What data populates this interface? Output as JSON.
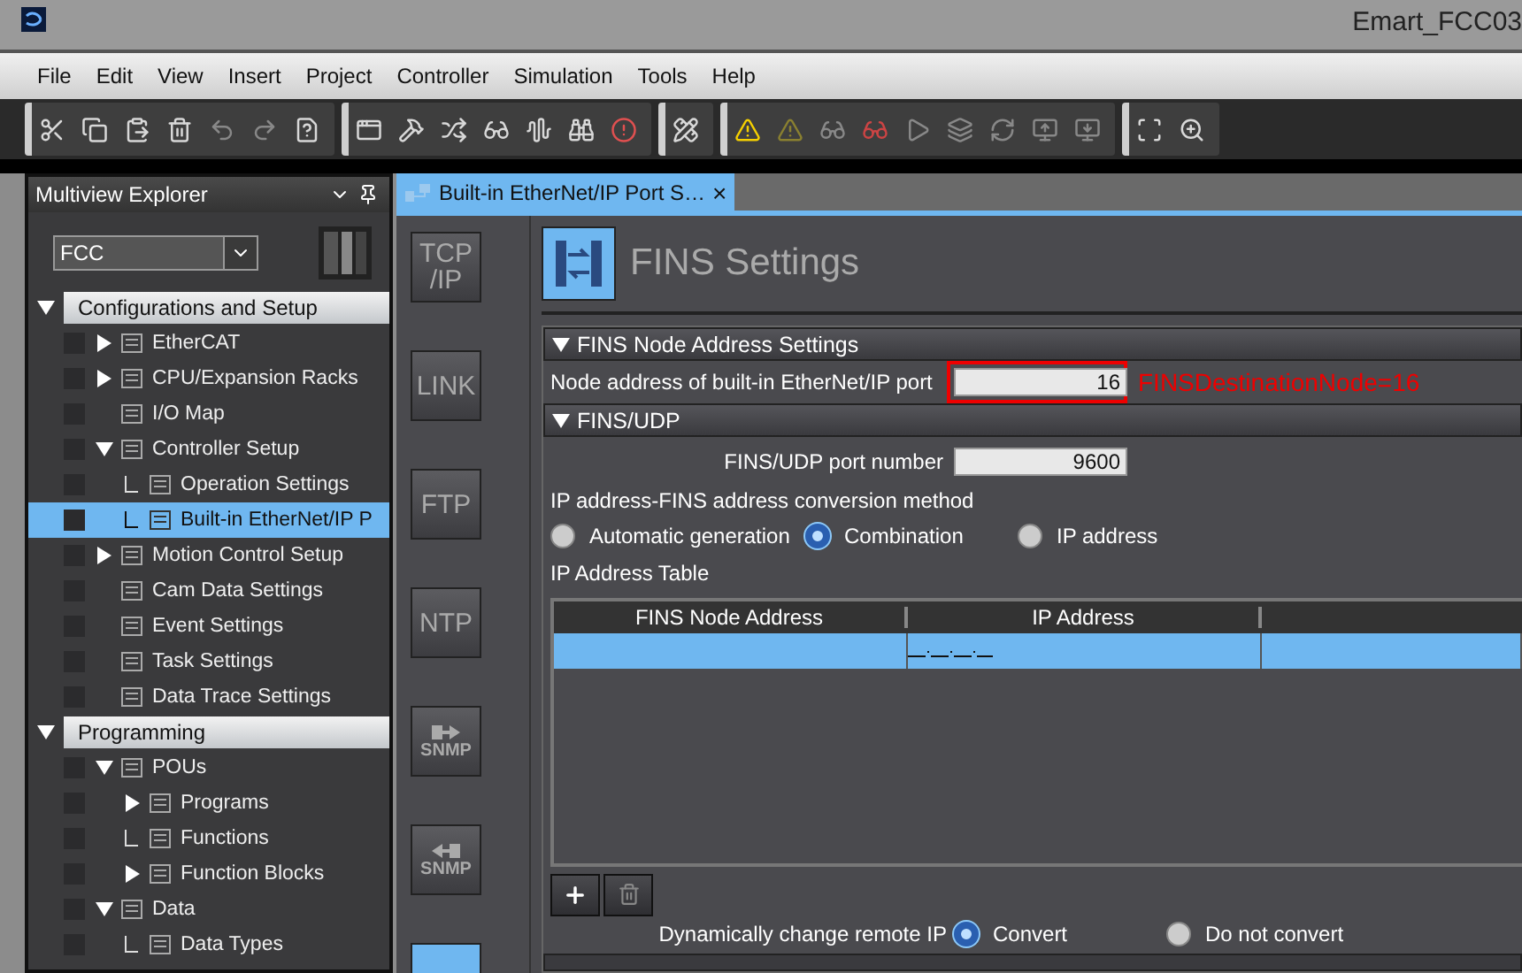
{
  "window": {
    "title": "Emart_FCC03"
  },
  "menu": [
    "File",
    "Edit",
    "View",
    "Insert",
    "Project",
    "Controller",
    "Simulation",
    "Tools",
    "Help"
  ],
  "explorer": {
    "title": "Multiview Explorer",
    "device": "FCC",
    "tree": [
      {
        "kind": "category",
        "label": "Configurations and Setup",
        "expanded": true,
        "selected": false,
        "children": [
          {
            "kind": "item",
            "label": "EtherCAT",
            "expanded": false,
            "selected": false
          },
          {
            "kind": "item",
            "label": "CPU/Expansion Racks",
            "expanded": false,
            "selected": false
          },
          {
            "kind": "item",
            "label": "I/O Map",
            "selected": false
          },
          {
            "kind": "item",
            "label": "Controller Setup",
            "expanded": true,
            "selected": false,
            "children": [
              {
                "kind": "item",
                "label": "Operation Settings",
                "selected": false
              },
              {
                "kind": "item",
                "label": "Built-in EtherNet/IP P",
                "selected": true
              }
            ]
          },
          {
            "kind": "item",
            "label": "Motion Control Setup",
            "expanded": false,
            "selected": false
          },
          {
            "kind": "item",
            "label": "Cam Data Settings",
            "selected": false
          },
          {
            "kind": "item",
            "label": "Event Settings",
            "selected": false
          },
          {
            "kind": "item",
            "label": "Task Settings",
            "selected": false
          },
          {
            "kind": "item",
            "label": "Data Trace Settings",
            "selected": false
          }
        ]
      },
      {
        "kind": "category",
        "label": "Programming",
        "expanded": true,
        "selected": false,
        "children": [
          {
            "kind": "item",
            "label": "POUs",
            "expanded": true,
            "selected": false,
            "children": [
              {
                "kind": "item",
                "label": "Programs",
                "expanded": false,
                "selected": false
              },
              {
                "kind": "item",
                "label": "Functions",
                "selected": false
              },
              {
                "kind": "item",
                "label": "Function Blocks",
                "expanded": false,
                "selected": false
              }
            ]
          },
          {
            "kind": "item",
            "label": "Data",
            "expanded": true,
            "selected": false,
            "children": [
              {
                "kind": "item",
                "label": "Data Types",
                "selected": false
              }
            ]
          }
        ]
      }
    ]
  },
  "editor": {
    "tab": {
      "label": "Built-in EtherNet/IP Port S…",
      "selected": true,
      "close": "×"
    },
    "nav": [
      {
        "kind": "text",
        "label": "TCP\n/IP",
        "selected": false
      },
      {
        "kind": "text",
        "label": "LINK",
        "selected": false
      },
      {
        "kind": "text",
        "label": "FTP",
        "selected": false
      },
      {
        "kind": "text",
        "label": "NTP",
        "selected": false
      },
      {
        "kind": "send",
        "label": "SNMP",
        "selected": false
      },
      {
        "kind": "receive",
        "label": "SNMP",
        "selected": false
      },
      {
        "kind": "fins",
        "selected": true
      }
    ],
    "title": "FINS Settings",
    "node_settings": {
      "title": "FINS Node Address Settings",
      "expanded": true,
      "field": {
        "label": "Node address of built-in EtherNet/IP port",
        "value": "16",
        "highlighted": true
      },
      "annotation": "FINSDestinationNode=16"
    },
    "udp": {
      "title": "FINS/UDP",
      "expanded": true,
      "port": {
        "label": "FINS/UDP port number",
        "value": "9600"
      },
      "conversion": {
        "label": "IP address-FINS address conversion method",
        "options": [
          {
            "label": "Automatic generation",
            "selected": false
          },
          {
            "label": "Combination",
            "selected": true
          },
          {
            "label": "IP address",
            "selected": false
          }
        ]
      },
      "table": {
        "title": "IP Address Table",
        "columns": [
          "FINS Node Address",
          "IP Address"
        ],
        "rows": [
          {
            "selected": true
          }
        ]
      },
      "dynamic": {
        "label": "Dynamically change remote IP",
        "options": [
          {
            "label": "Convert",
            "selected": true
          },
          {
            "label": "Do not convert",
            "selected": false
          }
        ]
      }
    }
  }
}
